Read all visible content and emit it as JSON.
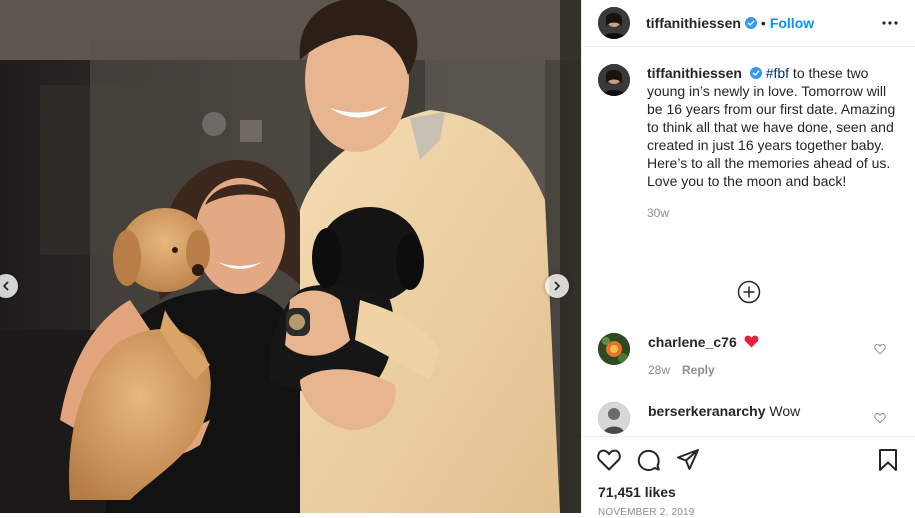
{
  "post": {
    "username": "tiffanithiessen",
    "follow_label": "Follow",
    "separator": "•"
  },
  "caption": {
    "username": "tiffanithiessen",
    "hashtag": "#fbf",
    "text": " to these two young in’s newly in love. Tomorrow will be 16 years from our first date. Amazing to think all that we have done, seen and created in just 16 years together baby. Here’s to all the memories ahead of us. Love you to the moon and back!",
    "time": "30w"
  },
  "comments": [
    {
      "username": "charlene_c76",
      "text": "",
      "time": "28w",
      "reply_label": "Reply",
      "emoji": "heart"
    },
    {
      "username": "berserkeranarchy",
      "text": "Wow"
    }
  ],
  "footer": {
    "likes": "71,451 likes",
    "date": "NOVEMBER 2, 2019"
  },
  "icons": {
    "verified_color": "#3897f0",
    "accent": "#0095f6",
    "heart_emoji_color": "#e0263d"
  }
}
